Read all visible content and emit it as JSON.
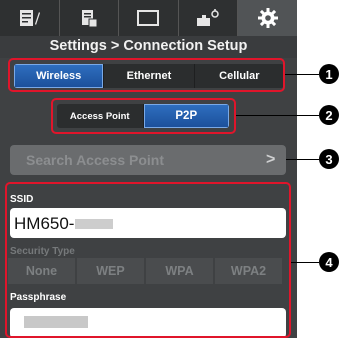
{
  "tabs": [
    {
      "icon": "edit-list-icon"
    },
    {
      "icon": "document-icon"
    },
    {
      "icon": "display-icon"
    },
    {
      "icon": "camera-settings-icon"
    },
    {
      "icon": "gear-icon"
    }
  ],
  "active_tab": "gear-icon",
  "title": "Settings > Connection Setup",
  "connection_tabs": {
    "wireless": "Wireless",
    "ethernet": "Ethernet",
    "cellular": "Cellular",
    "selected": "Wireless"
  },
  "mode_tabs": {
    "access_point": "Access Point",
    "p2p": "P2P",
    "selected": "P2P"
  },
  "search": {
    "placeholder": "Search Access Point",
    "chevron": ">"
  },
  "ssid": {
    "label": "SSID",
    "value": "HM650-"
  },
  "security": {
    "label": "Security Type",
    "options": [
      "None",
      "WEP",
      "WPA",
      "WPA2"
    ]
  },
  "passphrase": {
    "label": "Passphrase"
  },
  "callouts": [
    "1",
    "2",
    "3",
    "4"
  ],
  "colors": {
    "accent": "#1b4f9a",
    "highlight": "#e0152b",
    "background": "#3f4143"
  }
}
